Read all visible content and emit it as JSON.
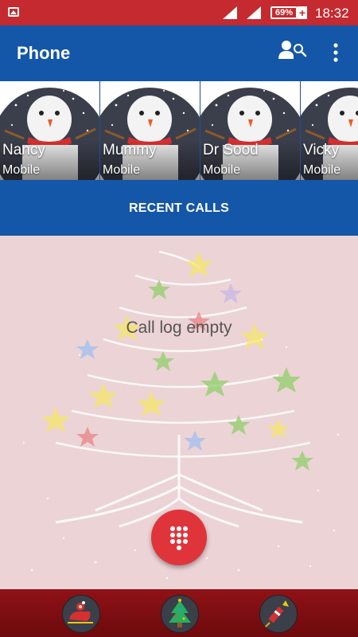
{
  "status_bar": {
    "battery": "69%",
    "battery_plus": "+",
    "time": "18:32"
  },
  "app_bar": {
    "title": "Phone"
  },
  "favorites": [
    {
      "name": "Nancy",
      "type": "Mobile"
    },
    {
      "name": "Mummy",
      "type": "Mobile"
    },
    {
      "name": "Dr Sood",
      "type": "Mobile"
    },
    {
      "name": "Vicky",
      "type": "Mobile"
    }
  ],
  "tabs": {
    "recent_calls": "RECENT CALLS"
  },
  "call_log": {
    "empty_text": "Call log empty"
  },
  "bottom_bar": {
    "icons": [
      "santa-sleigh-icon",
      "christmas-tree-icon",
      "firework-rocket-icon"
    ]
  },
  "colors": {
    "status_bar": "#c42a2f",
    "app_bar": "#1456a8",
    "fab": "#e0343b",
    "bottom_bar": "#8f1216"
  }
}
